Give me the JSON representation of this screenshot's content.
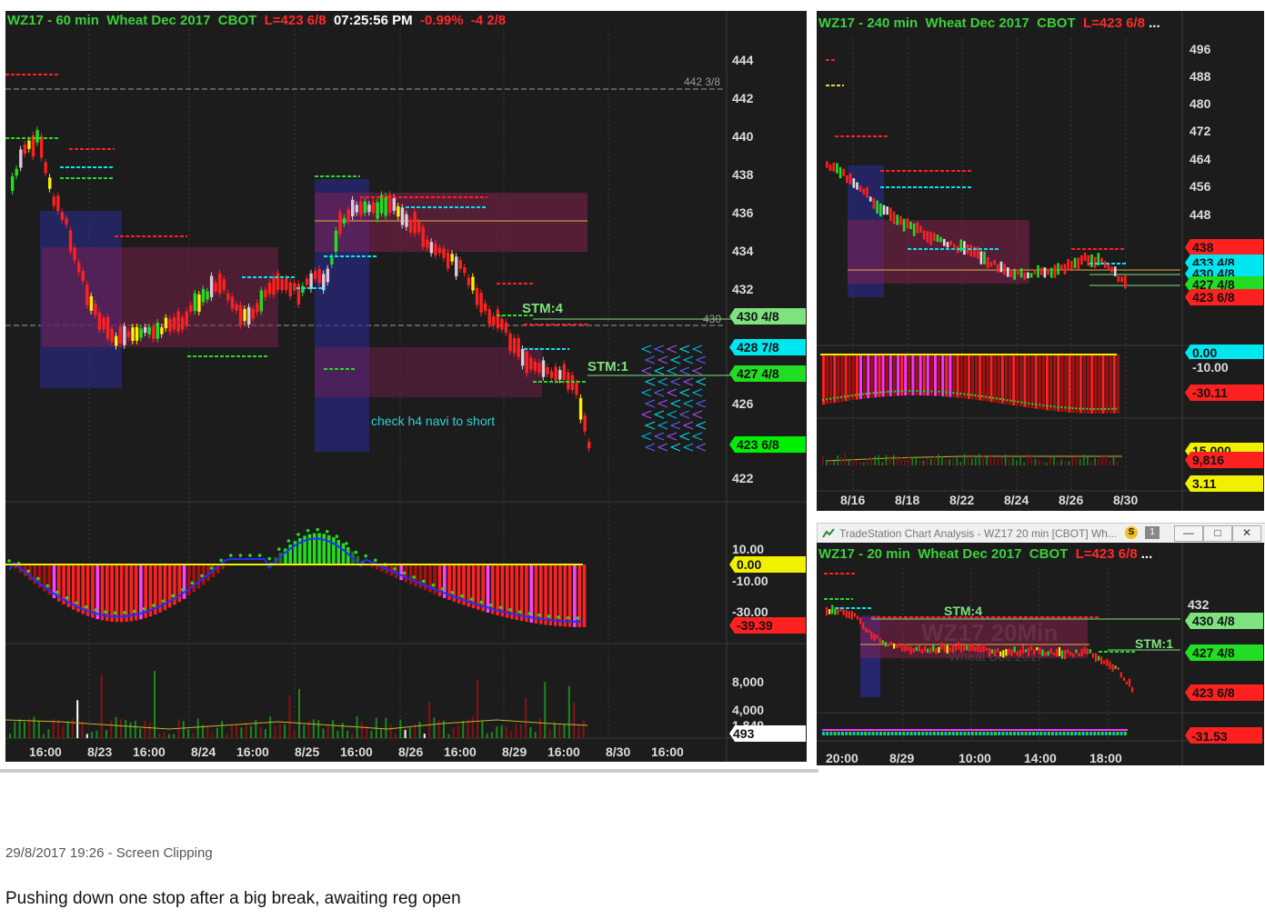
{
  "main": {
    "header": {
      "symbol": "WZ17 - 60 min",
      "name": "Wheat Dec 2017",
      "exchange": "CBOT",
      "last": "L=423 6/8",
      "time": "07:25:56 PM",
      "pct": "-0.99%",
      "chg": "-4 2/8"
    },
    "y_ticks": [
      "444",
      "442",
      "440",
      "438",
      "436",
      "434",
      "432",
      "426",
      "422"
    ],
    "level_label": "442 3/8",
    "level_430": "430",
    "price_tags": [
      {
        "text": "430 4/8",
        "color": "#7ee27e"
      },
      {
        "text": "428 7/8",
        "color": "#00e6f0"
      },
      {
        "text": "427 4/8",
        "color": "#22dd22"
      },
      {
        "text": "423 6/8",
        "color": "#00ee00"
      }
    ],
    "stm_labels": [
      "STM:4",
      "STM:1"
    ],
    "annotation": "check h4 navi to short",
    "osc_ticks": [
      "10.00",
      "-10.00",
      "-30.00"
    ],
    "osc_tags": [
      {
        "text": "0.00",
        "color": "#f0f000"
      },
      {
        "text": "-39.39",
        "color": "#ff2020"
      }
    ],
    "vol_ticks": [
      "8,000",
      "4,000",
      "1,849"
    ],
    "vol_tag": "493",
    "x_labels": [
      "16:00",
      "8/23",
      "16:00",
      "8/24",
      "16:00",
      "8/25",
      "16:00",
      "8/26",
      "16:00",
      "8/29",
      "16:00",
      "8/30",
      "16:00"
    ]
  },
  "chart240": {
    "header": {
      "symbol": "WZ17 - 240 min",
      "name": "Wheat Dec 2017",
      "exchange": "CBOT",
      "last": "L=423 6/8",
      "more": "..."
    },
    "y_ticks": [
      "496",
      "488",
      "480",
      "472",
      "464",
      "456",
      "448"
    ],
    "price_tags": [
      {
        "text": "438",
        "color": "#ff2020"
      },
      {
        "text": "433 4/8",
        "color": "#00e6f0"
      },
      {
        "text": "430 4/8",
        "color": "#00e6f0"
      },
      {
        "text": "427 4/8",
        "color": "#22dd22"
      },
      {
        "text": "423 6/8",
        "color": "#ff2020"
      }
    ],
    "osc_tags": [
      {
        "text": "0.00",
        "color": "#00e6f0"
      },
      {
        "text": "-10.00",
        "color": "#1c1c1c"
      },
      {
        "text": "-30.11",
        "color": "#ff2020"
      }
    ],
    "vol_tags": [
      {
        "text": "15,000",
        "color": "#f0f000"
      },
      {
        "text": "9,816",
        "color": "#ff2020"
      },
      {
        "text": "3.11",
        "color": "#f0f000"
      }
    ],
    "x_labels": [
      "8/16",
      "8/18",
      "8/22",
      "8/24",
      "8/26",
      "8/30"
    ]
  },
  "chart20": {
    "window_title": "TradeStation Chart Analysis - WZ17 20 min [CBOT] Wh...",
    "window_buttons": [
      "S",
      "1"
    ],
    "header": {
      "symbol": "WZ17 - 20 min",
      "name": "Wheat Dec 2017",
      "exchange": "CBOT",
      "last": "L=423 6/8",
      "more": "..."
    },
    "watermark": "WZ17 20Min",
    "watermark_sub": "Wheat Dec 2017",
    "y_ticks": [
      "432"
    ],
    "price_tags": [
      {
        "text": "430 4/8",
        "color": "#7ee27e"
      },
      {
        "text": "427 4/8",
        "color": "#22dd22"
      },
      {
        "text": "423 6/8",
        "color": "#ff2020"
      }
    ],
    "osc_tag": "-31.53",
    "stm_labels": [
      "STM:4",
      "STM:1"
    ],
    "x_labels": [
      "20:00",
      "8/29",
      "10:00",
      "14:00",
      "18:00"
    ]
  },
  "caption": "29/8/2017 19:26 - Screen Clipping",
  "note": "Pushing down one stop after a big break, awaiting reg open",
  "colors": {
    "bg": "#1c1c1c",
    "green": "#3bd13b",
    "red": "#ff2a2a",
    "cyan": "#00e6f0",
    "yellow": "#f0f000"
  }
}
